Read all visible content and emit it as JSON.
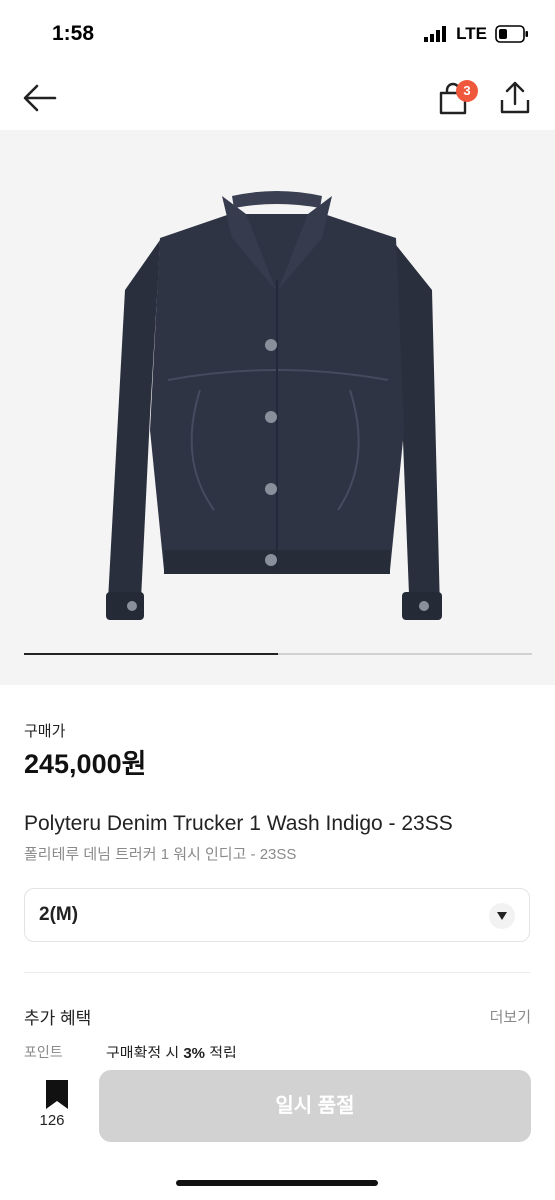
{
  "status": {
    "time": "1:58",
    "network": "LTE"
  },
  "nav": {
    "cart_count": "3"
  },
  "product": {
    "price_label": "구매가",
    "price": "245,000원",
    "name_en": "Polyteru Denim Trucker 1 Wash Indigo - 23SS",
    "name_ko": "폴리테루 데님 트러커 1 워시 인디고 - 23SS",
    "carousel_progress": 0.5
  },
  "size_select": {
    "value": "2(M)"
  },
  "benefits": {
    "title": "추가 혜택",
    "more": "더보기",
    "point_label": "포인트",
    "point_text_prefix": "구매확정 시 ",
    "point_rate": "3%",
    "point_text_suffix": " 적립"
  },
  "bottom": {
    "wish_count": "126",
    "buy_label": "일시 품절"
  },
  "colors": {
    "badge": "#f0583e",
    "disabled_button": "#d2d2d2",
    "jacket": "#2c3140"
  }
}
